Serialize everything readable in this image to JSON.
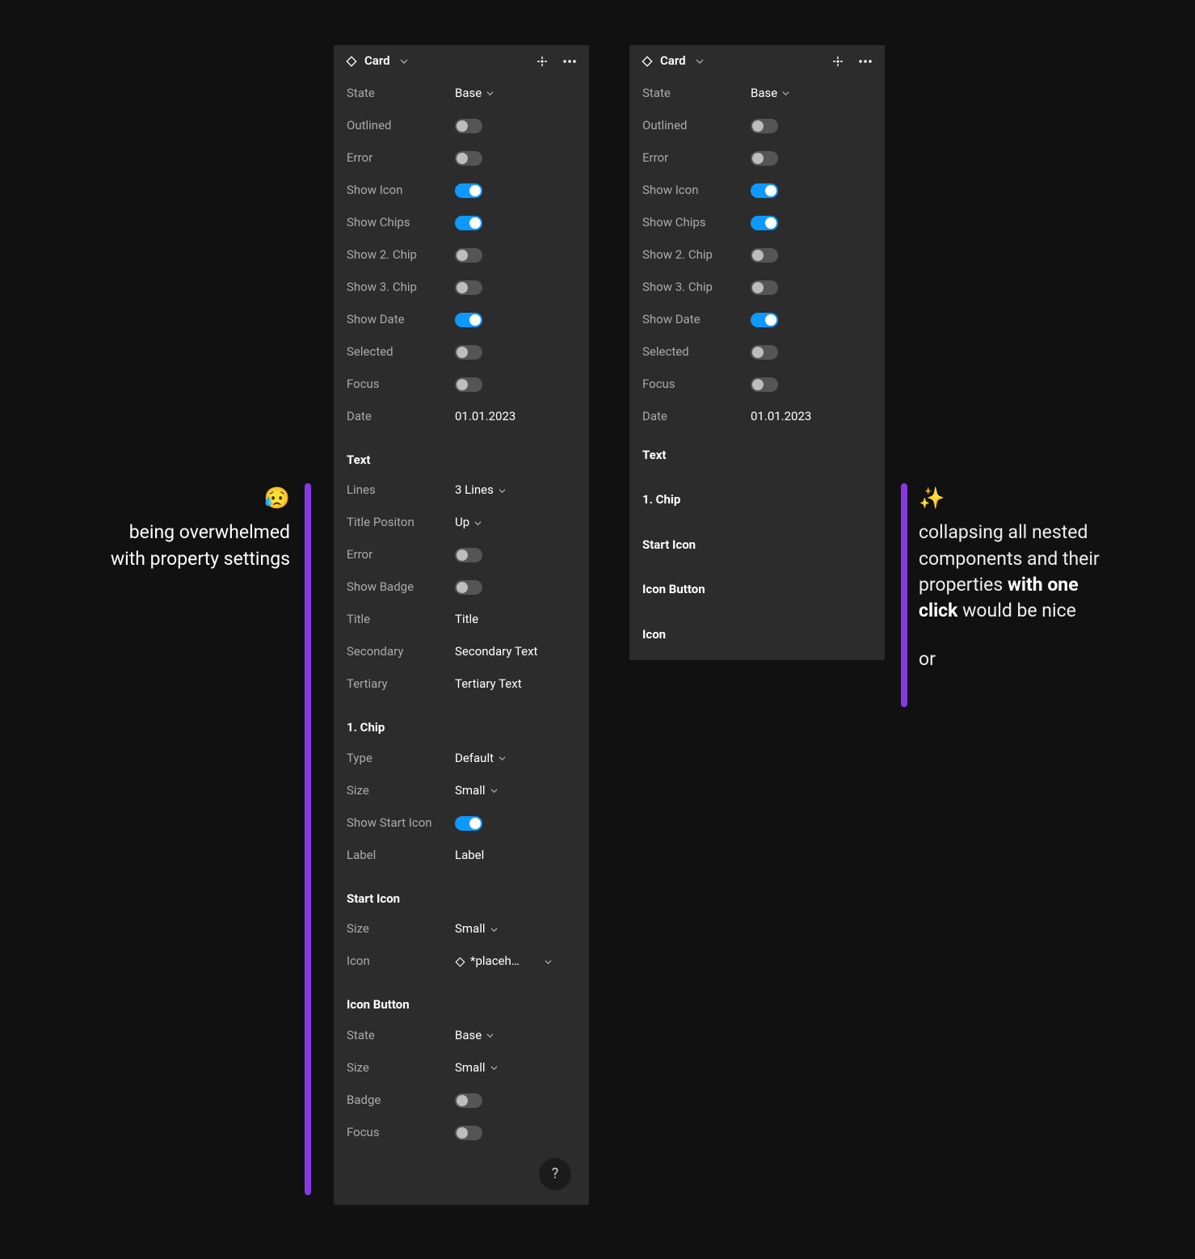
{
  "header": {
    "title": "Card"
  },
  "card": {
    "state_label": "State",
    "state_value": "Base",
    "outlined_label": "Outlined",
    "outlined_on": false,
    "error_label": "Error",
    "error_on": false,
    "show_icon_label": "Show Icon",
    "show_icon_on": true,
    "show_chips_label": "Show Chips",
    "show_chips_on": true,
    "show_chip2_label": "Show 2. Chip",
    "show_chip2_on": false,
    "show_chip3_label": "Show 3. Chip",
    "show_chip3_on": false,
    "show_date_label": "Show Date",
    "show_date_on": true,
    "selected_label": "Selected",
    "selected_on": false,
    "focus_label": "Focus",
    "focus_on": false,
    "date_label": "Date",
    "date_value": "01.01.2023"
  },
  "text_section": {
    "title": "Text",
    "lines_label": "Lines",
    "lines_value": "3 Lines",
    "title_pos_label": "Title Positon",
    "title_pos_value": "Up",
    "error_label": "Error",
    "error_on": false,
    "show_badge_label": "Show Badge",
    "show_badge_on": false,
    "title_label": "Title",
    "title_value": "Title",
    "secondary_label": "Secondary",
    "secondary_value": "Secondary Text",
    "tertiary_label": "Tertiary",
    "tertiary_value": "Tertiary Text"
  },
  "chip_section": {
    "title": "1. Chip",
    "type_label": "Type",
    "type_value": "Default",
    "size_label": "Size",
    "size_value": "Small",
    "show_start_icon_label": "Show Start Icon",
    "show_start_icon_on": true,
    "label_label": "Label",
    "label_value": "Label"
  },
  "start_icon_section": {
    "title": "Start Icon",
    "size_label": "Size",
    "size_value": "Small",
    "icon_label": "Icon",
    "icon_value": "*placeh…"
  },
  "icon_button_section": {
    "title": "Icon Button",
    "state_label": "State",
    "state_value": "Base",
    "size_label": "Size",
    "size_value": "Small",
    "badge_label": "Badge",
    "badge_on": false,
    "focus_label": "Focus",
    "focus_on": false
  },
  "collapsed": {
    "text": "Text",
    "chip1": "1. Chip",
    "start_icon": "Start Icon",
    "icon_button": "Icon Button",
    "icon": "Icon"
  },
  "captions": {
    "left_emoji": "😥",
    "left_text": "being overwhelmed with property settings",
    "right_emoji": "✨",
    "right_pre": "collapsing all nested components and their properties ",
    "right_bold": "with one click",
    "right_post": " would be nice",
    "right_or": "or"
  },
  "help": "?"
}
